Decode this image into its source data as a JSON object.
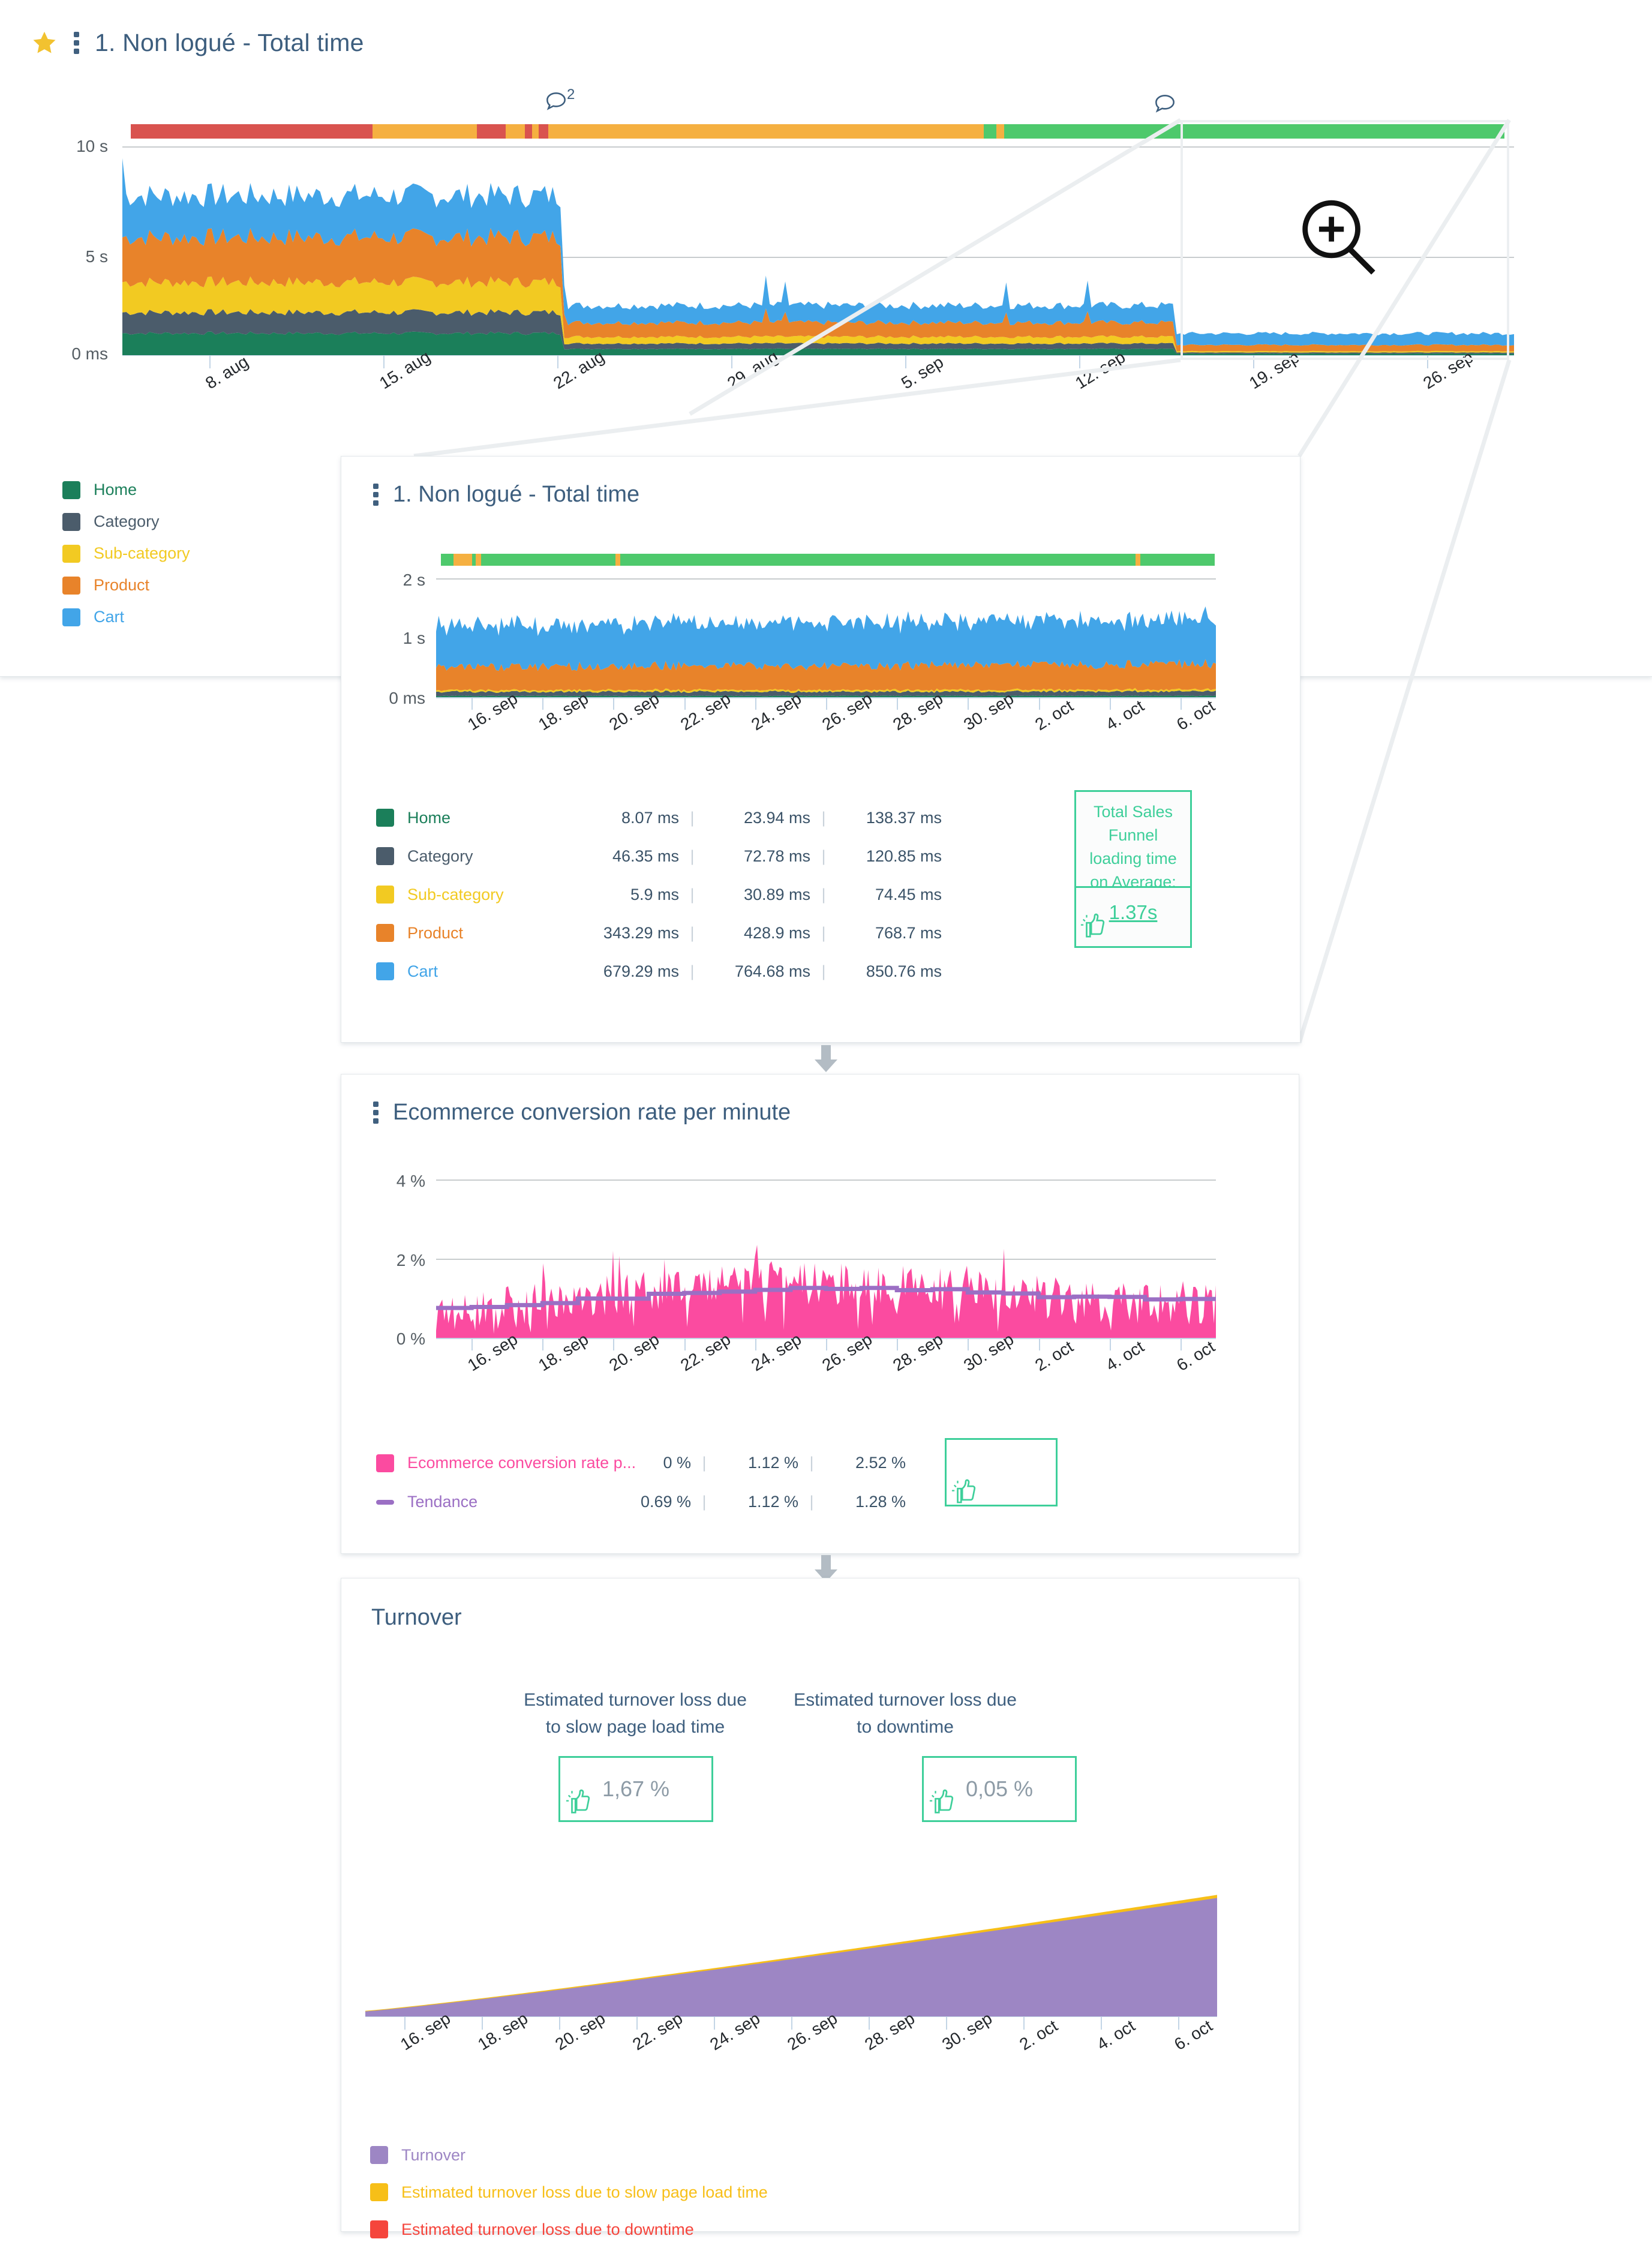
{
  "panel1": {
    "title": "1. Non logué - Total time",
    "star_icon": "star-icon",
    "menu_icon": "kebab-menu-icon",
    "comment_badge_1": "2",
    "y_ticks": [
      "10 s",
      "5 s",
      "0 ms"
    ],
    "x_labels": [
      "8. aug",
      "15. aug",
      "22. aug",
      "29. aug",
      "5. sep",
      "12. sep",
      "19. sep",
      "26. sep"
    ],
    "legend": [
      {
        "label": "Home",
        "color": "#1b7f5a"
      },
      {
        "label": "Category",
        "color": "#4b5c6b"
      },
      {
        "label": "Sub-category",
        "color": "#f2ca22"
      },
      {
        "label": "Product",
        "color": "#e8832a"
      },
      {
        "label": "Cart",
        "color": "#42a5e8"
      }
    ],
    "zoom_icon": "magnifier-plus-icon"
  },
  "panel2": {
    "title": "1. Non logué - Total time",
    "menu_icon": "kebab-menu-icon",
    "y_ticks": [
      "2 s",
      "1 s",
      "0 ms"
    ],
    "x_labels": [
      "16. sep",
      "18. sep",
      "20. sep",
      "22. sep",
      "24. sep",
      "26. sep",
      "28. sep",
      "30. sep",
      "2. oct",
      "4. oct",
      "6. oct"
    ],
    "table": [
      {
        "label": "Home",
        "color": "#1b7f5a",
        "min": "8.07 ms",
        "avg": "23.94 ms",
        "max": "138.37 ms"
      },
      {
        "label": "Category",
        "color": "#4b5c6b",
        "min": "46.35 ms",
        "avg": "72.78 ms",
        "max": "120.85 ms"
      },
      {
        "label": "Sub-category",
        "color": "#f2ca22",
        "min": "5.9 ms",
        "avg": "30.89 ms",
        "max": "74.45 ms"
      },
      {
        "label": "Product",
        "color": "#e8832a",
        "min": "343.29 ms",
        "avg": "428.9 ms",
        "max": "768.7 ms"
      },
      {
        "label": "Cart",
        "color": "#42a5e8",
        "min": "679.29 ms",
        "avg": "764.68 ms",
        "max": "850.76 ms"
      }
    ],
    "kpi": {
      "caption": "Total Sales Funnel loading time on Average:",
      "value": "1.37s",
      "thumb_icon": "thumbs-up-icon"
    }
  },
  "panel3": {
    "title": "Ecommerce conversion rate per minute",
    "menu_icon": "kebab-menu-icon",
    "y_ticks": [
      "4 %",
      "2 %",
      "0 %"
    ],
    "x_labels": [
      "16. sep",
      "18. sep",
      "20. sep",
      "22. sep",
      "24. sep",
      "26. sep",
      "28. sep",
      "30. sep",
      "2. oct",
      "4. oct",
      "6. oct"
    ],
    "table": [
      {
        "label": "Ecommerce conversion rate p...",
        "color": "#fb4ba0",
        "type": "area",
        "min": "0 %",
        "avg": "1.12 %",
        "max": "2.52 %"
      },
      {
        "label": "Tendance",
        "color": "#9b6fc4",
        "type": "line",
        "min": "0.69 %",
        "avg": "1.12 %",
        "max": "1.28 %"
      }
    ],
    "thumb_icon": "thumbs-up-icon"
  },
  "panel4": {
    "title": "Turnover",
    "metrics": [
      {
        "title": "Estimated turnover loss due to slow page load time",
        "value": "1,67 %",
        "thumb_icon": "thumbs-up-icon"
      },
      {
        "title": "Estimated turnover loss due to downtime",
        "value": "0,05 %",
        "thumb_icon": "thumbs-up-icon"
      }
    ],
    "x_labels": [
      "16. sep",
      "18. sep",
      "20. sep",
      "22. sep",
      "24. sep",
      "26. sep",
      "28. sep",
      "30. sep",
      "2. oct",
      "4. oct",
      "6. oct"
    ],
    "legend": [
      {
        "label": "Turnover",
        "color": "#9d86c4"
      },
      {
        "label": "Estimated turnover loss due to slow page load time",
        "color": "#f7bf18"
      },
      {
        "label": "Estimated turnover loss due to downtime",
        "color": "#f5453c"
      }
    ]
  },
  "chart_data": [
    {
      "id": "panel1-total-time",
      "type": "area",
      "title": "1. Non logué - Total time",
      "stacked": true,
      "ylabel": "",
      "ylim": [
        0,
        11
      ],
      "yticks": [
        0,
        5,
        10
      ],
      "ytick_labels": [
        "0 ms",
        "5 s",
        "10 s"
      ],
      "xlabel": "",
      "x": [
        "8. aug",
        "15. aug",
        "22. aug",
        "29. aug",
        "5. sep",
        "12. sep",
        "19. sep",
        "26. sep"
      ],
      "grid": true,
      "legend_position": "bottom-left",
      "series": [
        {
          "name": "Home",
          "color": "#1b7f5a",
          "values": [
            1.2,
            1.2,
            1.2,
            0.35,
            0.3,
            0.3,
            0.1,
            0.05
          ]
        },
        {
          "name": "Category",
          "color": "#4b5c6b",
          "values": [
            1.1,
            1.1,
            1.1,
            0.25,
            0.25,
            0.25,
            0.08,
            0.05
          ]
        },
        {
          "name": "Sub-category",
          "color": "#f2ca22",
          "values": [
            1.6,
            1.6,
            1.6,
            0.35,
            0.35,
            0.35,
            0.07,
            0.05
          ]
        },
        {
          "name": "Product",
          "color": "#e8832a",
          "values": [
            2.4,
            2.4,
            2.4,
            0.75,
            0.75,
            0.75,
            0.35,
            0.35
          ]
        },
        {
          "name": "Cart",
          "color": "#42a5e8",
          "values": [
            2.2,
            2.2,
            2.2,
            0.9,
            0.9,
            0.9,
            0.65,
            0.65
          ]
        }
      ],
      "status_bar": [
        {
          "status": "error",
          "color": "#d9534f",
          "from_pct": 0,
          "to_pct": 17.6
        },
        {
          "status": "warning",
          "color": "#f5b041",
          "from_pct": 17.6,
          "to_pct": 25.2
        },
        {
          "status": "error",
          "color": "#d9534f",
          "from_pct": 25.2,
          "to_pct": 27.3
        },
        {
          "status": "warning",
          "color": "#f5b041",
          "from_pct": 27.3,
          "to_pct": 28.7
        },
        {
          "status": "error",
          "color": "#d9534f",
          "from_pct": 28.7,
          "to_pct": 29.2
        },
        {
          "status": "warning",
          "color": "#f5b041",
          "from_pct": 29.2,
          "to_pct": 29.7
        },
        {
          "status": "error",
          "color": "#d9534f",
          "from_pct": 29.7,
          "to_pct": 30.4
        },
        {
          "status": "warning",
          "color": "#f5b041",
          "from_pct": 30.4,
          "to_pct": 62.1
        },
        {
          "status": "ok",
          "color": "#4ec96c",
          "from_pct": 62.1,
          "to_pct": 63.0
        },
        {
          "status": "warning",
          "color": "#f5b041",
          "from_pct": 63.0,
          "to_pct": 63.6
        },
        {
          "status": "ok",
          "color": "#4ec96c",
          "from_pct": 63.6,
          "to_pct": 100
        }
      ]
    },
    {
      "id": "panel2-total-time-zoom",
      "type": "area",
      "title": "1. Non logué - Total time",
      "stacked": true,
      "ylim": [
        0,
        2.2
      ],
      "yticks": [
        0,
        1,
        2
      ],
      "ytick_labels": [
        "0 ms",
        "1 s",
        "2 s"
      ],
      "x": [
        "16. sep",
        "18. sep",
        "20. sep",
        "22. sep",
        "24. sep",
        "26. sep",
        "28. sep",
        "30. sep",
        "2. oct",
        "4. oct",
        "6. oct"
      ],
      "grid": true,
      "series": [
        {
          "name": "Home",
          "color": "#1b7f5a",
          "avg_ms": 23.94,
          "min_ms": 8.07,
          "max_ms": 138.37
        },
        {
          "name": "Category",
          "color": "#4b5c6b",
          "avg_ms": 72.78,
          "min_ms": 46.35,
          "max_ms": 120.85
        },
        {
          "name": "Sub-category",
          "color": "#f2ca22",
          "avg_ms": 30.89,
          "min_ms": 5.9,
          "max_ms": 74.45
        },
        {
          "name": "Product",
          "color": "#e8832a",
          "avg_ms": 428.9,
          "min_ms": 343.29,
          "max_ms": 768.7
        },
        {
          "name": "Cart",
          "color": "#42a5e8",
          "avg_ms": 764.68,
          "min_ms": 679.29,
          "max_ms": 850.76
        }
      ],
      "total_average": "1.37s",
      "status_bar": [
        {
          "status": "ok",
          "color": "#4ec96c",
          "from_pct": 0,
          "to_pct": 1.6
        },
        {
          "status": "warning",
          "color": "#f5b041",
          "from_pct": 1.6,
          "to_pct": 4.0
        },
        {
          "status": "ok",
          "color": "#4ec96c",
          "from_pct": 4.0,
          "to_pct": 4.5
        },
        {
          "status": "warning",
          "color": "#f5b041",
          "from_pct": 4.5,
          "to_pct": 5.2
        },
        {
          "status": "ok",
          "color": "#4ec96c",
          "from_pct": 5.2,
          "to_pct": 22.6
        },
        {
          "status": "warning",
          "color": "#f5b041",
          "from_pct": 22.6,
          "to_pct": 23.2
        },
        {
          "status": "ok",
          "color": "#4ec96c",
          "from_pct": 23.2,
          "to_pct": 89.8
        },
        {
          "status": "warning",
          "color": "#f5b041",
          "from_pct": 89.8,
          "to_pct": 90.4
        },
        {
          "status": "ok",
          "color": "#4ec96c",
          "from_pct": 90.4,
          "to_pct": 100
        }
      ]
    },
    {
      "id": "panel3-conversion-rate",
      "type": "area",
      "title": "Ecommerce conversion rate per minute",
      "ylabel": "%",
      "ylim": [
        0,
        4.6
      ],
      "yticks": [
        0,
        2,
        4
      ],
      "ytick_labels": [
        "0 %",
        "2 %",
        "4 %"
      ],
      "x": [
        "16. sep",
        "18. sep",
        "20. sep",
        "22. sep",
        "24. sep",
        "26. sep",
        "28. sep",
        "30. sep",
        "2. oct",
        "4. oct",
        "6. oct"
      ],
      "grid": true,
      "series": [
        {
          "name": "Ecommerce conversion rate p...",
          "color": "#fb4ba0",
          "type": "area",
          "min": 0,
          "avg": 1.12,
          "max": 2.52
        },
        {
          "name": "Tendance",
          "color": "#9b6fc4",
          "type": "step-line",
          "min": 0.69,
          "avg": 1.12,
          "max": 1.28
        }
      ]
    },
    {
      "id": "panel4-turnover",
      "type": "area",
      "title": "Turnover",
      "stacked": true,
      "x": [
        "16. sep",
        "18. sep",
        "20. sep",
        "22. sep",
        "24. sep",
        "26. sep",
        "28. sep",
        "30. sep",
        "2. oct",
        "4. oct",
        "6. oct"
      ],
      "grid": false,
      "series": [
        {
          "name": "Turnover",
          "color": "#9d86c4",
          "trend": "monotonic-increasing",
          "start_pct": 3,
          "end_pct": 92
        },
        {
          "name": "Estimated turnover loss due to slow page load time",
          "color": "#f7bf18",
          "loss_pct": 1.67
        },
        {
          "name": "Estimated turnover loss due to downtime",
          "color": "#f5453c",
          "loss_pct": 0.05
        }
      ]
    }
  ]
}
